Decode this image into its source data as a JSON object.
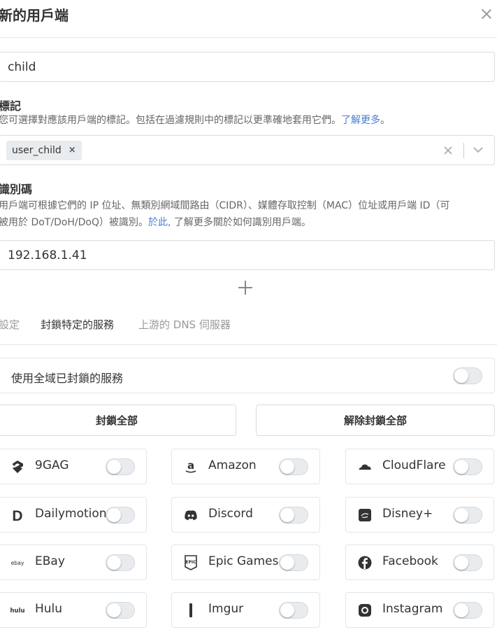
{
  "modal": {
    "title": "新的用戶端"
  },
  "client_name": {
    "value": "child"
  },
  "tags": {
    "title": "標記",
    "description": "您可選擇對應該用戶端的標記。包括在過濾規則中的標記以更準確地套用它們。",
    "learn_more_link": "了解更多",
    "description_end": "。",
    "selected": [
      "user_child"
    ],
    "remove_glyph": "×"
  },
  "identifiers": {
    "title": "識別碼",
    "description_line1": "用戶端可根據它們的 IP 位址、無類別網域間路由（CIDR）、媒體存取控制（MAC）位址或用戶端 ID（可",
    "description_line2_start": "被用於 DoT/DoH/DoQ）被識別。",
    "here_link": "於此,",
    "description_line2_end": " 了解更多關於如何識別用戶端。",
    "values": [
      "192.168.1.41"
    ]
  },
  "tabs": [
    {
      "label": "設定",
      "active": false
    },
    {
      "label": "封鎖特定的服務",
      "active": true
    },
    {
      "label": "上游的 DNS 伺服器",
      "active": false
    }
  ],
  "global_blocked": {
    "label": "使用全域已封鎖的服務",
    "enabled": false
  },
  "actions": {
    "block_all": "封鎖全部",
    "unblock_all": "解除封鎖全部"
  },
  "services": [
    {
      "name": "9GAG",
      "icon": "9gag-icon",
      "enabled": false
    },
    {
      "name": "Amazon",
      "icon": "amazon-icon",
      "enabled": false
    },
    {
      "name": "CloudFlare",
      "icon": "cloudflare-icon",
      "enabled": false
    },
    {
      "name": "Dailymotion",
      "icon": "dailymotion-icon",
      "enabled": false
    },
    {
      "name": "Discord",
      "icon": "discord-icon",
      "enabled": false
    },
    {
      "name": "Disney+",
      "icon": "disney-plus-icon",
      "enabled": false
    },
    {
      "name": "EBay",
      "icon": "ebay-icon",
      "enabled": false
    },
    {
      "name": "Epic Games",
      "icon": "epic-games-icon",
      "enabled": false
    },
    {
      "name": "Facebook",
      "icon": "facebook-icon",
      "enabled": false
    },
    {
      "name": "Hulu",
      "icon": "hulu-icon",
      "enabled": false
    },
    {
      "name": "Imgur",
      "icon": "imgur-icon",
      "enabled": false
    },
    {
      "name": "Instagram",
      "icon": "instagram-icon",
      "enabled": false
    }
  ],
  "icon_text": {
    "ebay": "ebay",
    "hulu": "hulu",
    "epic": "EPIC",
    "dailymotion": "D",
    "amazon": "a"
  },
  "colors": {
    "link": "#467fcf",
    "toggle_off": "#e9ecef",
    "text_primary": "#333333",
    "text_muted": "#666666",
    "tab_inactive": "#999999"
  }
}
